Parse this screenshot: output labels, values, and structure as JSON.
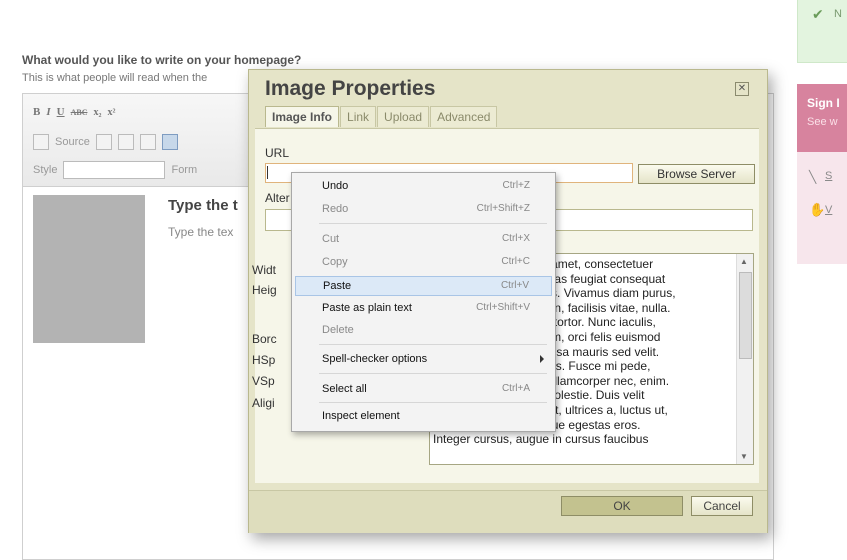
{
  "page": {
    "question": "What would you like to write on your homepage?",
    "subtitle": "This is what people will read when the",
    "content_title": "Type the t",
    "content_text": "Type the tex"
  },
  "toolbar": {
    "bold": "B",
    "italic": "I",
    "underline": "U",
    "strike": "ABC",
    "subscript": "x₂",
    "superscript": "x²",
    "source": "Source",
    "style_label": "Style",
    "format_label": "Form"
  },
  "right_panel": {
    "green_letter": "N",
    "pink_title": "Sign I",
    "pink_sub": "See w",
    "link1": "S",
    "link2": "V"
  },
  "dialog": {
    "title": "Image Properties",
    "close": "✕",
    "tabs": [
      {
        "label": "Image Info"
      },
      {
        "label": "Link"
      },
      {
        "label": "Upload"
      },
      {
        "label": "Advanced"
      }
    ],
    "url_label": "URL",
    "alt_label": "Alter",
    "browse_button": "Browse Server",
    "labels": {
      "width": "Widt",
      "height": "Heig",
      "border": "Borc",
      "hspace": "HSp",
      "vspace": "VSp",
      "align": "Aligi"
    },
    "preview_lines": [
      "Lorem ipsum dolor sit amet, consectetuer",
      "adipiscing elit. Maecenas feugiat consequat",
      "diam. Maecenas metus. Vivamus diam purus,",
      "cursus a, commodo non, facilisis vitae, nulla.",
      "Aenean dictum lacinia tortor. Nunc iaculis,",
      "nibh non iaculis aliquam, orci felis euismod",
      "neque, sed ornare massa mauris sed velit.",
      "Nulla pretium mi et risus. Fusce mi pede,",
      "tempor id, cursus ac, ullamcorper nec, enim.",
      "Sed tortor. Curabitur molestie. Duis velit",
      "augue, condimentum at, ultrices a, luctus ut,",
      "orci. Donec pellentesque egestas eros.",
      "Integer cursus, augue in cursus faucibus"
    ],
    "ok_button": "OK",
    "cancel_button": "Cancel"
  },
  "context_menu": {
    "undo": {
      "label": "Undo",
      "shortcut": "Ctrl+Z"
    },
    "redo": {
      "label": "Redo",
      "shortcut": "Ctrl+Shift+Z"
    },
    "cut": {
      "label": "Cut",
      "shortcut": "Ctrl+X"
    },
    "copy": {
      "label": "Copy",
      "shortcut": "Ctrl+C"
    },
    "paste": {
      "label": "Paste",
      "shortcut": "Ctrl+V"
    },
    "paste_plain": {
      "label": "Paste as plain text",
      "shortcut": "Ctrl+Shift+V"
    },
    "delete": {
      "label": "Delete"
    },
    "spell": {
      "label": "Spell-checker options"
    },
    "select_all": {
      "label": "Select all",
      "shortcut": "Ctrl+A"
    },
    "inspect": {
      "label": "Inspect element"
    }
  }
}
